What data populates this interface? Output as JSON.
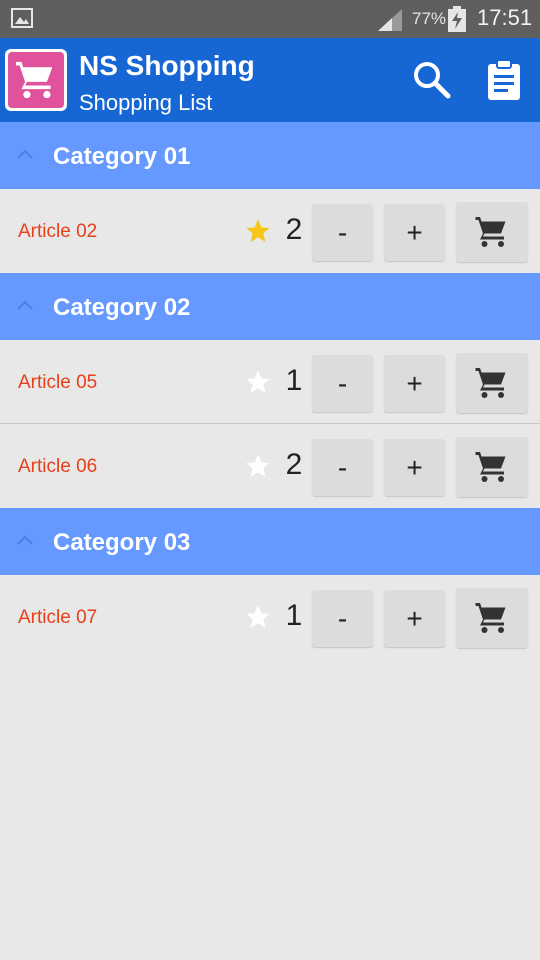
{
  "status_bar": {
    "battery_percent": "77%",
    "time": "17:51",
    "icons": [
      "gallery-icon",
      "signal-icon",
      "battery-charging-icon"
    ]
  },
  "app_bar": {
    "title": "NS Shopping",
    "subtitle": "Shopping List",
    "icons": [
      "cart-logo-icon",
      "search-icon",
      "clipboard-icon"
    ],
    "color": "#1666d4"
  },
  "colors": {
    "category_header": "#6699ff",
    "article_text": "#e8401a",
    "star_active": "#f5c518",
    "star_inactive": "#ffffff"
  },
  "categories": [
    {
      "title": "Category 01",
      "items": [
        {
          "name": "Article 02",
          "qty": "2",
          "starred": true,
          "minus": "-",
          "plus": "+"
        }
      ]
    },
    {
      "title": "Category 02",
      "items": [
        {
          "name": "Article 05",
          "qty": "1",
          "starred": false,
          "minus": "-",
          "plus": "+"
        },
        {
          "name": "Article 06",
          "qty": "2",
          "starred": false,
          "minus": "-",
          "plus": "+"
        }
      ]
    },
    {
      "title": "Category 03",
      "items": [
        {
          "name": "Article 07",
          "qty": "1",
          "starred": false,
          "minus": "-",
          "plus": "+"
        }
      ]
    }
  ]
}
